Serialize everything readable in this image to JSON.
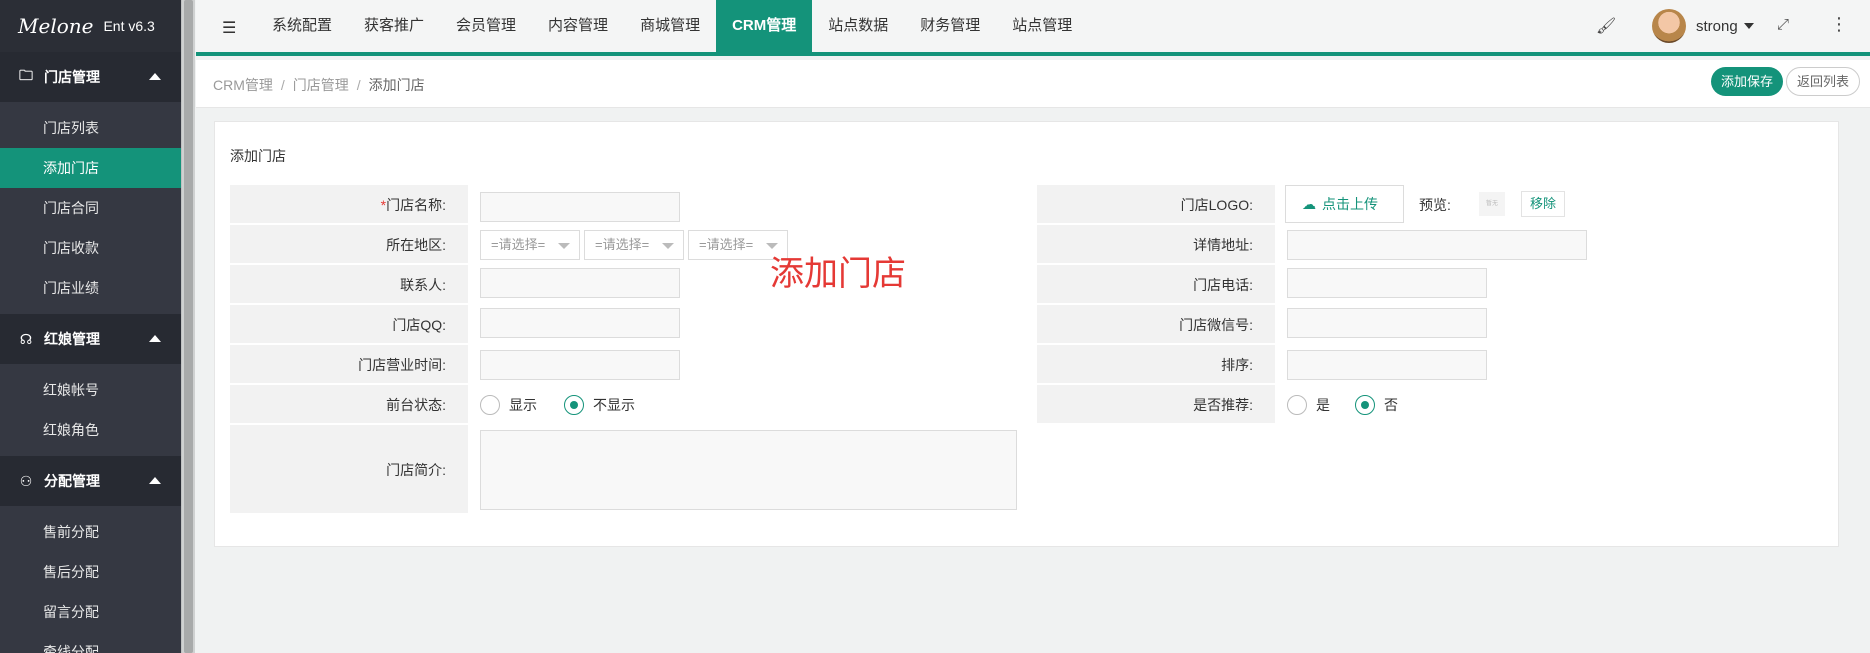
{
  "logo": {
    "script": "Melone",
    "version": "Ent v6.3"
  },
  "sidebar": {
    "groups": [
      {
        "label": "门店管理",
        "icon": "folder-icon",
        "items": [
          "门店列表",
          "添加门店",
          "门店合同",
          "门店收款",
          "门店业绩"
        ]
      },
      {
        "label": "红娘管理",
        "icon": "headset-icon",
        "items": [
          "红娘帐号",
          "红娘角色"
        ]
      },
      {
        "label": "分配管理",
        "icon": "user-icon",
        "items": [
          "售前分配",
          "售后分配",
          "留言分配",
          "牵线分配"
        ]
      }
    ],
    "active_item": "添加门店"
  },
  "topnav": {
    "items": [
      "系统配置",
      "获客推广",
      "会员管理",
      "内容管理",
      "商城管理",
      "CRM管理",
      "站点数据",
      "财务管理",
      "站点管理"
    ],
    "active": "CRM管理",
    "user": "strong"
  },
  "breadcrumb": {
    "items": [
      "CRM管理",
      "门店管理",
      "添加门店"
    ],
    "save_label": "添加保存",
    "back_label": "返回列表"
  },
  "form": {
    "title": "添加门店",
    "overlay_title": "添加门店",
    "left": {
      "name_label": "门店名称:",
      "region_label": "所在地区:",
      "region_placeholder": "=请选择=",
      "contact_label": "联系人:",
      "qq_label": "门店QQ:",
      "hours_label": "门店营业时间:",
      "status_label": "前台状态:",
      "status_options": [
        "显示",
        "不显示"
      ],
      "status_selected": "不显示",
      "intro_label": "门店简介:"
    },
    "right": {
      "logo_label": "门店LOGO:",
      "upload_label": "点击上传",
      "preview_label": "预览:",
      "preview_placeholder": "暂无",
      "remove_label": "移除",
      "address_label": "详情地址:",
      "phone_label": "门店电话:",
      "wechat_label": "门店微信号:",
      "sort_label": "排序:",
      "recommend_label": "是否推荐:",
      "recommend_options": [
        "是",
        "否"
      ],
      "recommend_selected": "否"
    }
  },
  "colors": {
    "accent": "#14937a",
    "sidebar_bg": "#2f323b",
    "overlay_red": "#e53935"
  }
}
